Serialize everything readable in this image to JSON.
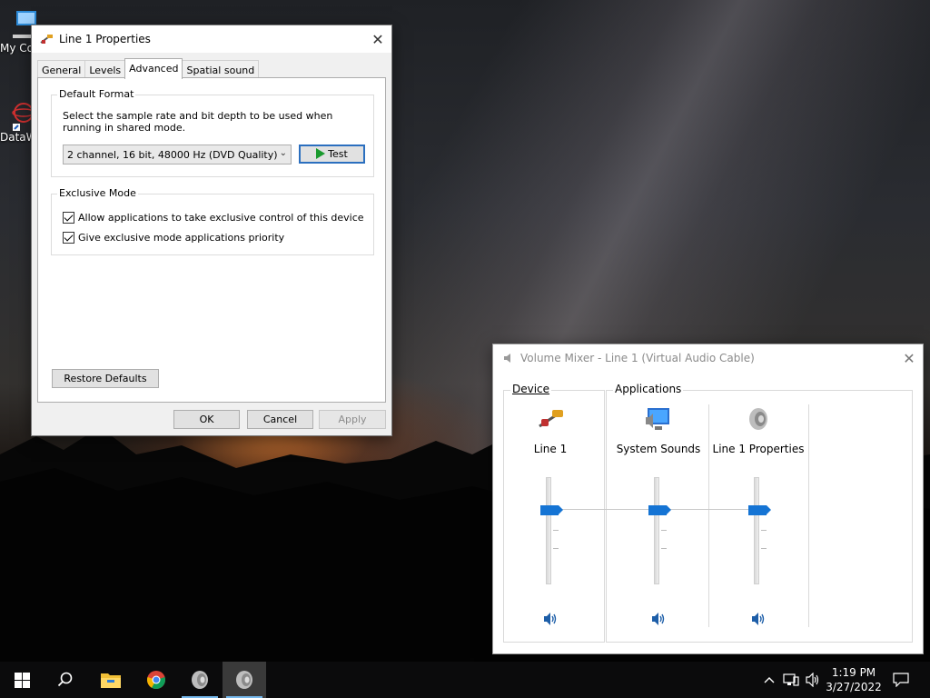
{
  "desktop": {
    "icons": [
      {
        "label": "My Co",
        "icon": "computer-icon"
      },
      {
        "label": "DataW",
        "icon": "dataw-app-icon"
      }
    ]
  },
  "properties_dialog": {
    "title": "Line 1 Properties",
    "tabs": [
      {
        "label": "General",
        "active": false
      },
      {
        "label": "Levels",
        "active": false
      },
      {
        "label": "Advanced",
        "active": true
      },
      {
        "label": "Spatial sound",
        "active": false
      }
    ],
    "default_format": {
      "legend": "Default Format",
      "description": "Select the sample rate and bit depth to be used when running in shared mode.",
      "selected_format": "2 channel, 16 bit, 48000 Hz (DVD Quality)",
      "test_label": "Test"
    },
    "exclusive_mode": {
      "legend": "Exclusive Mode",
      "options": [
        {
          "label": "Allow applications to take exclusive control of this device",
          "checked": true
        },
        {
          "label": "Give exclusive mode applications priority",
          "checked": true
        }
      ]
    },
    "restore_defaults_label": "Restore Defaults",
    "ok_label": "OK",
    "cancel_label": "Cancel",
    "apply_label": "Apply"
  },
  "volume_mixer": {
    "title": "Volume Mixer - Line 1 (Virtual Audio Cable)",
    "device_header": "Device",
    "applications_header": "Applications",
    "channels": [
      {
        "name": "Line 1",
        "icon": "audio-cable-icon",
        "level": 0.7,
        "muted": false
      },
      {
        "name": "System Sounds",
        "icon": "system-sounds-icon",
        "level": 0.7,
        "muted": false
      },
      {
        "name": "Line 1 Properties",
        "icon": "speaker-app-icon",
        "level": 0.7,
        "muted": false
      }
    ]
  },
  "taskbar": {
    "pinned": [
      "windows-start-icon",
      "search-icon",
      "file-explorer-icon",
      "chrome-icon",
      "speaker-app-icon",
      "speaker-app-icon"
    ],
    "time": "1:19 PM",
    "date": "3/27/2022"
  },
  "colors": {
    "accent": "#1574d4",
    "test_play": "#1a9a2e"
  }
}
